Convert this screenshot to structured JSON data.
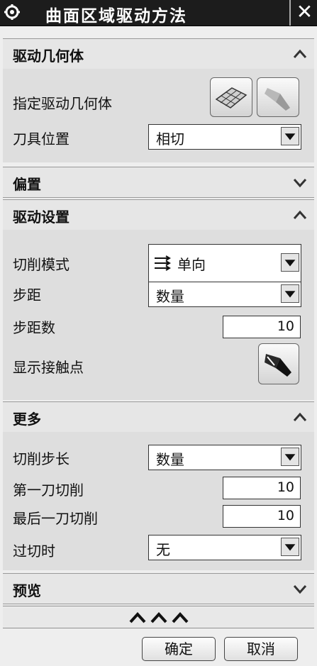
{
  "window": {
    "title": "曲面区域驱动方法",
    "close_glyph": "✕"
  },
  "sections": {
    "drive_geometry": {
      "title": "驱动几何体",
      "specify_label": "指定驱动几何体",
      "tool_position_label": "刀具位置",
      "tool_position_value": "相切"
    },
    "offset": {
      "title": "偏置"
    },
    "drive_settings": {
      "title": "驱动设置",
      "cut_mode_label": "切削模式",
      "cut_mode_value": "单向",
      "stepover_label": "步距",
      "stepover_value": "数量",
      "stepover_count_label": "步距数",
      "stepover_count_value": "10",
      "show_contact_label": "显示接触点"
    },
    "more": {
      "title": "更多",
      "cut_step_label": "切削步长",
      "cut_step_value": "数量",
      "first_cut_label": "第一刀切削",
      "first_cut_value": "10",
      "last_cut_label": "最后一刀切削",
      "last_cut_value": "10",
      "overcut_label": "过切时",
      "overcut_value": "无"
    },
    "preview": {
      "title": "预览"
    }
  },
  "footer": {
    "ok_label": "确定",
    "cancel_label": "取消"
  },
  "icons": {
    "window": "gear-icon",
    "collapse": "chevron-up-icon",
    "expand": "chevron-down-icon",
    "surface": "surface-grid-icon",
    "flashlight": "flashlight-icon",
    "more_options": "triple-chevron-up-icon"
  }
}
